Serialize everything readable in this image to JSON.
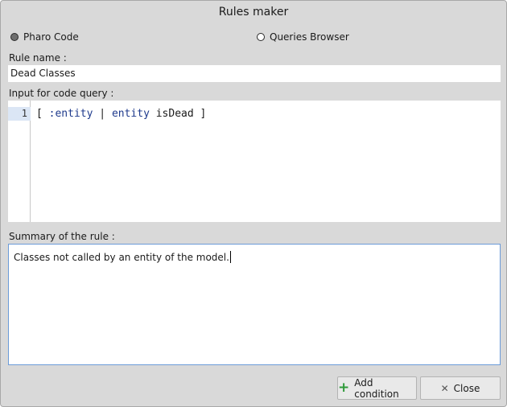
{
  "window": {
    "title": "Rules maker"
  },
  "mode": {
    "options": [
      {
        "label": "Pharo Code",
        "selected": true
      },
      {
        "label": "Queries Browser",
        "selected": false
      }
    ]
  },
  "rule_name": {
    "label": "Rule name :",
    "value": "Dead Classes"
  },
  "code_query": {
    "label": "Input for code query :",
    "line_number": "1",
    "tokens": {
      "open": "[ ",
      "param": ":entity",
      "bar": " | ",
      "receiver": "entity",
      "message": " isDead ]"
    }
  },
  "summary": {
    "label": "Summary of the rule :",
    "value": "Classes not called by an entity of the model."
  },
  "buttons": {
    "add_condition": "Add condition",
    "close": "Close"
  },
  "icons": {
    "add": "plus-icon",
    "close": "x-icon"
  },
  "colors": {
    "accent_border": "#6b9bd8",
    "plus": "#2f9a3a",
    "line_highlight": "#dbe6f5"
  }
}
